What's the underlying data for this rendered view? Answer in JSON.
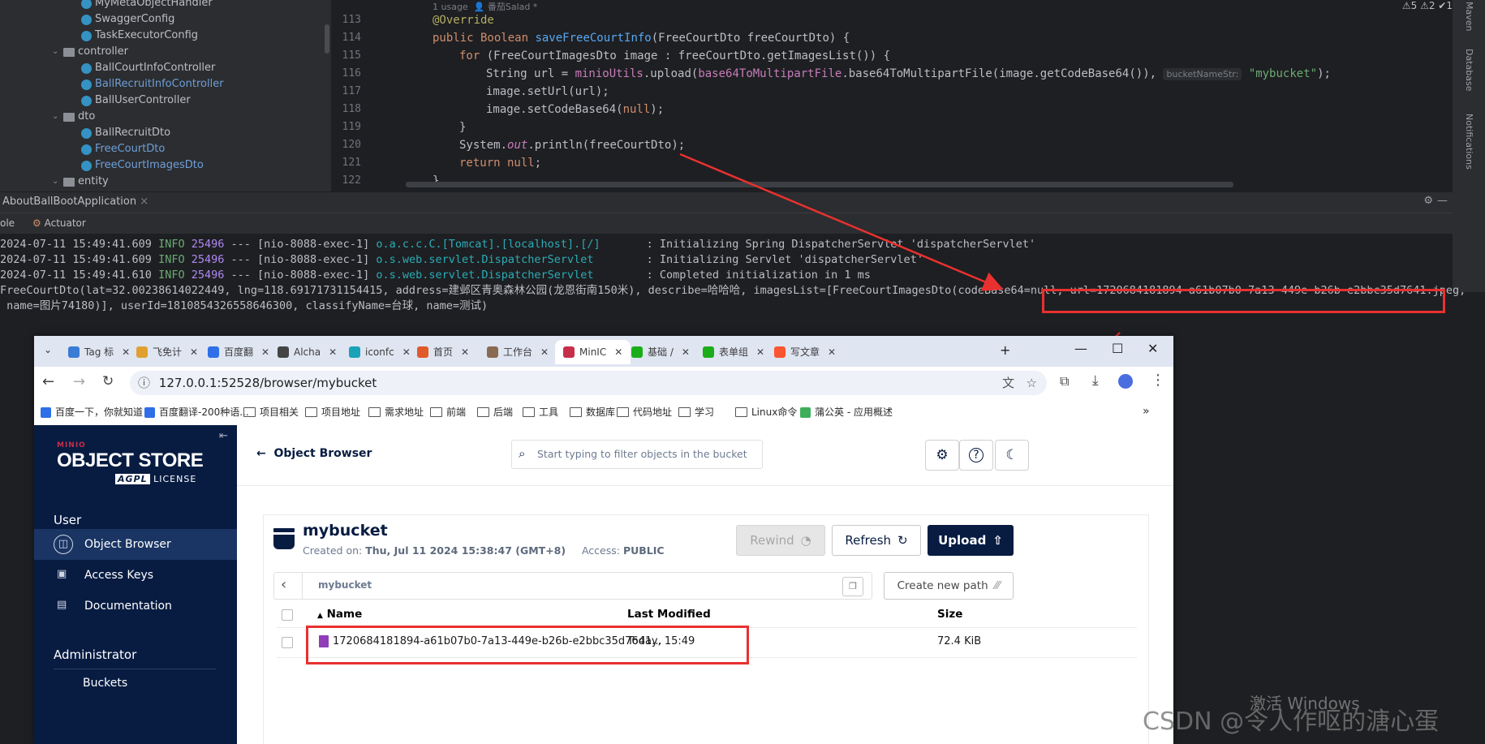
{
  "ide": {
    "project_tree": [
      {
        "label": "MyMetaObjectHandler",
        "kind": "class",
        "blue": false
      },
      {
        "label": "SwaggerConfig",
        "kind": "class",
        "blue": false
      },
      {
        "label": "TaskExecutorConfig",
        "kind": "class",
        "blue": false
      },
      {
        "label": "controller",
        "kind": "folder",
        "blue": false
      },
      {
        "label": "BallCourtInfoController",
        "kind": "class",
        "blue": false
      },
      {
        "label": "BallRecruitInfoController",
        "kind": "class",
        "blue": true
      },
      {
        "label": "BallUserController",
        "kind": "class",
        "blue": false
      },
      {
        "label": "dto",
        "kind": "folder",
        "blue": false
      },
      {
        "label": "BallRecruitDto",
        "kind": "class",
        "blue": false
      },
      {
        "label": "FreeCourtDto",
        "kind": "class",
        "blue": true
      },
      {
        "label": "FreeCourtImagesDto",
        "kind": "class",
        "blue": true
      },
      {
        "label": "entity",
        "kind": "folder",
        "blue": false
      }
    ],
    "usage_hint": "1 usage",
    "author_hint": "番茄Salad *",
    "inspections": "⚠5 ⚠2 ✔1",
    "line_numbers": [
      "113",
      "114",
      "115",
      "116",
      "117",
      "118",
      "119",
      "120",
      "121",
      "122"
    ],
    "code": {
      "l113": "@Override",
      "l114_kw": "public Boolean ",
      "l114_fn": "saveFreeCourtInfo",
      "l114_rest": "(FreeCourtDto freeCourtDto) {",
      "l115_kw": "for ",
      "l115_rest": "(FreeCourtImagesDto image : freeCourtDto.getImagesList()) {",
      "l116_a": "String url = ",
      "l116_b": "minioUtils",
      "l116_c": ".upload(",
      "l116_d": "base64ToMultipartFile",
      "l116_e": ".base64ToMultipartFile(image.getCodeBase64()), ",
      "l116_hint": "bucketNameStr:",
      "l116_str": "\"mybucket\"",
      "l116_end": ");",
      "l117": "image.setUrl(url);",
      "l118_a": "image.setCodeBase64(",
      "l118_kw": "null",
      "l118_b": ");",
      "l119": "}",
      "l120_a": "System.",
      "l120_out": "out",
      "l120_b": ".println(freeCourtDto);",
      "l121_kw": "return null",
      "l121_b": ";",
      "l122": "}"
    },
    "right_strip": [
      "Maven",
      "Database",
      "Notifications"
    ],
    "run_tab": "AboutBallBootApplication",
    "console_tabs": [
      "ole",
      "Actuator"
    ],
    "console": [
      {
        "ts": "2024-07-11 15:49:41.609",
        "level": "INFO",
        "pid": "25496",
        "thread": "--- [nio-8088-exec-1]",
        "logger": "o.a.c.c.C.[Tomcat].[localhost].[/]      ",
        "msg": " : Initializing Spring DispatcherServlet 'dispatcherServlet'"
      },
      {
        "ts": "2024-07-11 15:49:41.609",
        "level": "INFO",
        "pid": "25496",
        "thread": "--- [nio-8088-exec-1]",
        "logger": "o.s.web.servlet.DispatcherServlet       ",
        "msg": " : Initializing Servlet 'dispatcherServlet'"
      },
      {
        "ts": "2024-07-11 15:49:41.610",
        "level": "INFO",
        "pid": "25496",
        "thread": "--- [nio-8088-exec-1]",
        "logger": "o.s.web.servlet.DispatcherServlet       ",
        "msg": " : Completed initialization in 1 ms"
      }
    ],
    "dto_line1": "FreeCourtDto(lat=32.00238614022449, lng=118.69171731154415, address=建邺区青奥森林公园(龙恩街南150米), describe=哈哈哈, imagesList=[FreeCourtImagesDto(codeBase64=null, url=1720684181894-a61b07b0-7a13-449e-b26b-e2bbc35d7641.jpeg,",
    "dto_line2": " name=图片74180)], userId=1810854326558646300, classifyName=台球, name=测试)"
  },
  "browser": {
    "tabs": [
      {
        "label": "Tag 标",
        "color": "#3a7bd5"
      },
      {
        "label": "飞免计",
        "color": "#e0a030"
      },
      {
        "label": "百度翻",
        "color": "#2f6fe8"
      },
      {
        "label": "Alcha",
        "color": "#444444"
      },
      {
        "label": "iconfc",
        "color": "#1aa3b8"
      },
      {
        "label": "首页",
        "color": "#e05a2a"
      },
      {
        "label": "工作台",
        "color": "#8a6a50"
      },
      {
        "label": "MinIC",
        "color": "#c72e49",
        "active": true
      },
      {
        "label": "基础 /",
        "color": "#1aad19"
      },
      {
        "label": "表单组",
        "color": "#1aad19"
      },
      {
        "label": "写文章",
        "color": "#fc5531"
      }
    ],
    "url": "127.0.0.1:52528/browser/mybucket",
    "bookmarks": [
      "百度一下，你就知道",
      "百度翻译-200种语...",
      "项目相关",
      "项目地址",
      "需求地址",
      "前端",
      "后端",
      "工具",
      "数据库",
      "代码地址",
      "学习",
      "Linux命令",
      "蒲公英 - 应用概述"
    ]
  },
  "minio": {
    "brand_small": "MINIO",
    "brand_big": "OBJECT STORE",
    "brand_badge": "AGPL",
    "brand_license": "LICENSE",
    "section_user": "User",
    "nav": [
      {
        "label": "Object Browser",
        "active": true
      },
      {
        "label": "Access Keys",
        "active": false
      },
      {
        "label": "Documentation",
        "active": false
      }
    ],
    "section_admin": "Administrator",
    "nav_admin_partial": "Buckets",
    "back_label": "Object Browser",
    "search_placeholder": "Start typing to filter objects in the bucket",
    "bucket_name": "mybucket",
    "created_label": "Created on:",
    "created_value": "Thu, Jul 11 2024 15:38:47 (GMT+8)",
    "access_label": "Access:",
    "access_value": "PUBLIC",
    "rewind": "Rewind",
    "refresh": "Refresh",
    "upload": "Upload",
    "path": "mybucket",
    "create_path": "Create new path",
    "col_name": "Name",
    "col_modified": "Last Modified",
    "col_size": "Size",
    "rows": [
      {
        "name": "1720684181894-a61b07b0-7a13-449e-b26b-e2bbc35d7641...",
        "modified": "Today, 15:49",
        "size": "72.4 KiB"
      }
    ]
  },
  "watermarks": {
    "windows": "激活 Windows",
    "csdn": "CSDN @令人作呕的溏心蛋"
  },
  "colors": {
    "minio_navy": "#081c42",
    "annotation_red": "#e8312f"
  }
}
